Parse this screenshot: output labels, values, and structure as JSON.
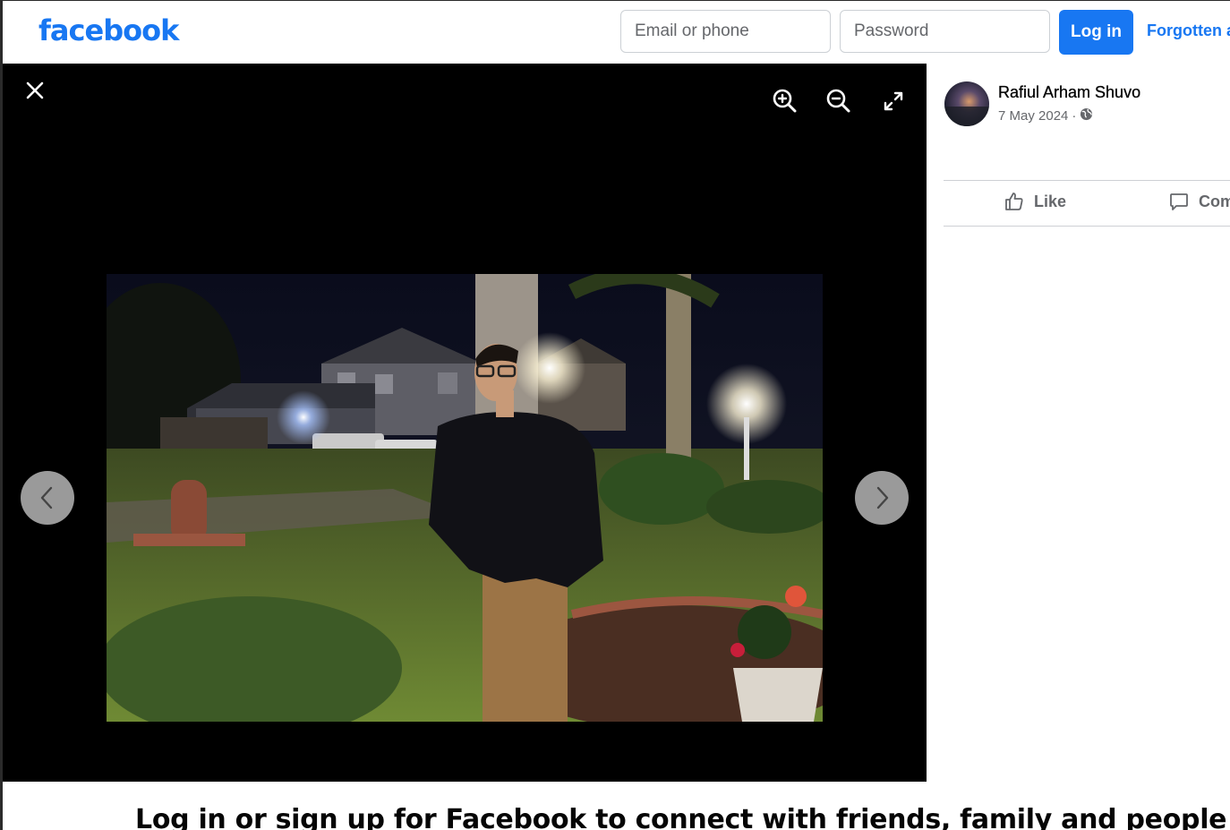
{
  "header": {
    "logo_text": "facebook",
    "email_placeholder": "Email or phone",
    "password_placeholder": "Password",
    "login_label": "Log in",
    "forgot_label": "Forgotten account?"
  },
  "viewer": {
    "icons": [
      "close-icon",
      "zoom-in-icon",
      "zoom-out-icon",
      "fullscreen-icon",
      "chevron-left-icon",
      "chevron-right-icon"
    ]
  },
  "post": {
    "author": "Rafiul Arham Shuvo",
    "date": "7 May 2024",
    "separator": "·",
    "privacy_icon": "globe-icon",
    "actions": {
      "like_label": "Like",
      "comment_label": "Comment"
    }
  },
  "footer": {
    "cta_text": "Log in or sign up for Facebook to connect with friends, family and people you know."
  },
  "colors": {
    "brand": "#1877f2",
    "viewer_bg": "#000000",
    "secondary_text": "#65676b"
  }
}
